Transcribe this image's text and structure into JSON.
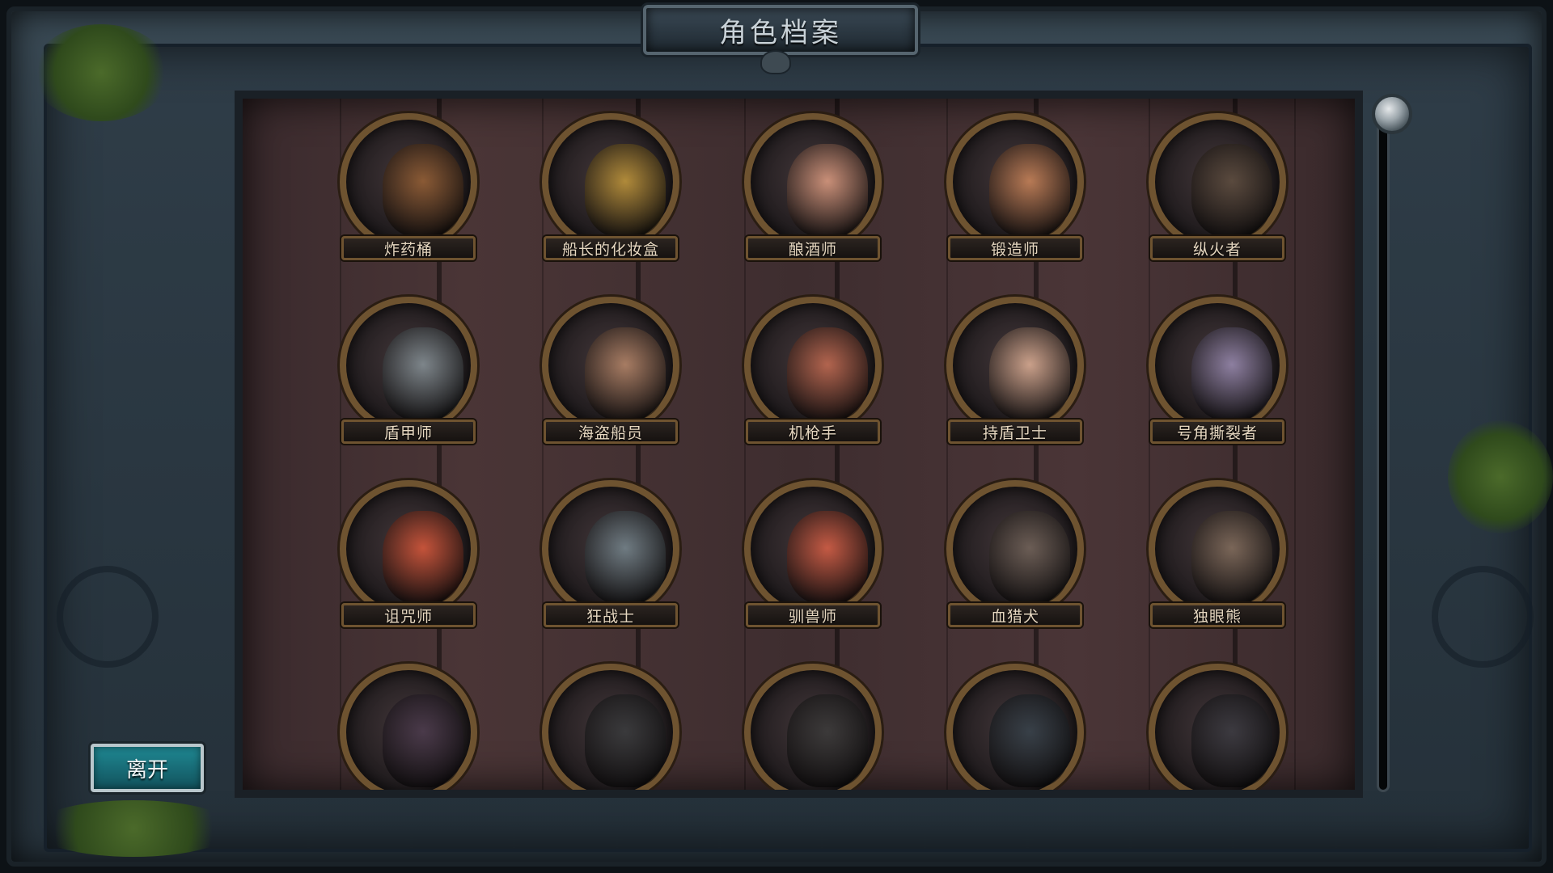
{
  "title": "角色档案",
  "exit_button": "离开",
  "characters": [
    {
      "name": "炸药桶",
      "icon": "powder-keg-icon",
      "color": "#8a5a35"
    },
    {
      "name": "船长的化妆盒",
      "icon": "vanity-chest-icon",
      "color": "#b08a3a"
    },
    {
      "name": "酿酒师",
      "icon": "brewer-icon",
      "color": "#c98f78"
    },
    {
      "name": "锻造师",
      "icon": "blacksmith-icon",
      "color": "#b87a55"
    },
    {
      "name": "纵火者",
      "icon": "arsonist-icon",
      "color": "#5a4a3e"
    },
    {
      "name": "盾甲师",
      "icon": "shield-armorer-icon",
      "color": "#7d858a"
    },
    {
      "name": "海盗船员",
      "icon": "pirate-crew-icon",
      "color": "#a77c63"
    },
    {
      "name": "机枪手",
      "icon": "machine-gunner-icon",
      "color": "#b2644e"
    },
    {
      "name": "持盾卫士",
      "icon": "shield-guard-icon",
      "color": "#caa08a"
    },
    {
      "name": "号角撕裂者",
      "icon": "horn-ripper-icon",
      "color": "#8d7fa0"
    },
    {
      "name": "诅咒师",
      "icon": "curser-icon",
      "color": "#c4533a"
    },
    {
      "name": "狂战士",
      "icon": "berserker-icon",
      "color": "#6f7b82"
    },
    {
      "name": "驯兽师",
      "icon": "beast-tamer-icon",
      "color": "#c45a44"
    },
    {
      "name": "血猎犬",
      "icon": "bloodhound-icon",
      "color": "#6b5d55"
    },
    {
      "name": "独眼熊",
      "icon": "one-eyed-bear-icon",
      "color": "#7a6658"
    },
    {
      "name": "",
      "icon": "witch-hat-silhouette-icon",
      "color": "#4a3a4a"
    },
    {
      "name": "",
      "icon": "rabbit-silhouette-icon",
      "color": "#3a3a3c"
    },
    {
      "name": "",
      "icon": "cyclops-silhouette-icon",
      "color": "#3c3a3a"
    },
    {
      "name": "",
      "icon": "straw-hat-ninja-icon",
      "color": "#384048"
    },
    {
      "name": "",
      "icon": "straw-hat-mushroom-icon",
      "color": "#3c3a40"
    }
  ]
}
